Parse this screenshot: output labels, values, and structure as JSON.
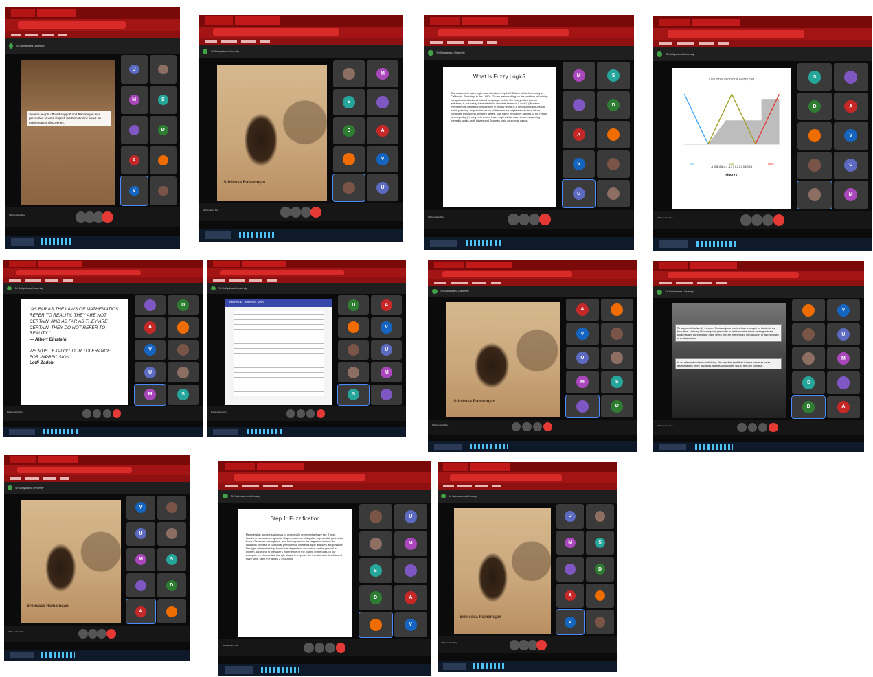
{
  "meeting": {
    "name": "Sri Sathyabama University",
    "day_label": "Mathematics Day"
  },
  "icons": [
    "tab-icon",
    "address-bar",
    "mic-icon",
    "camera-icon",
    "hand-icon",
    "end-call-icon",
    "search-icon"
  ],
  "colors": {
    "browser_red": "#a31414",
    "meet_dark": "#1f1f1f",
    "end_call": "#e53935",
    "accent_blue": "#4a8cff"
  },
  "shots": [
    {
      "slide": "book",
      "caption": "Several people offered support and Ramanujan was persuaded to write English mathematicians about his mathematical discoveries."
    },
    {
      "slide": "ramanujan",
      "stamp": "Srinivasa Ramanujan"
    },
    {
      "slide": "text",
      "heading": "What Is Fuzzy Logic?",
      "body": "The concept of fuzzy logic was introduced by Lotfi Zadeh of the University of California, Berkeley, in the 1960s. Zadeh was working on the problem of helping computers understand natural language, which, like many other human activities, is not easily translated into absolute terms of 0 and 1. (Whether everything is ultimately describable in binary terms is a philosophical question worth pursuing. In practice, much of the data we might want to feed into a computer exists in in-between states. The same frequently applies to the results of computing.) It may help to see fuzzy logic as the way human reasoning normally works, with binary and Boolean logic as special cases."
    },
    {
      "slide": "chart",
      "heading": "Defuzzification of a Fuzzy Set",
      "legend": [
        "Soft",
        "Avg",
        "Hard"
      ],
      "ticks": "-1 -0.8 -0.6 -0.4 -0.2 0 0.2 0.4 0.6 0.8 1",
      "figure": "Figure 7"
    },
    {
      "slide": "quote",
      "q1": "\"AS FAR AS THE LAWS OF MATHEMATICS REFER TO REALITY, THEY ARE NOT CERTAIN. AND AS FAR AS THEY ARE CERTAIN, THEY DO NOT REFER TO REALITY.\"",
      "a1": "— Albert Einstein",
      "q2": "WE MUST EXPLOIT OUR TOLERANCE FOR IMPRECISION.",
      "a2": "Lotfi Zadeh"
    },
    {
      "slide": "letter",
      "heading": "Letter to R. Krishna Rao"
    },
    {
      "slide": "ramanujan",
      "stamp": "Srinivasa Ramanujan"
    },
    {
      "slide": "portrait",
      "caption1": "To augment his family income, Ramanujan's mother took a couple of students as boarders. Noticing Ramanujan's precocity in mathematics these undergraduate students are purported to have given him an elementary introduction to all branches of mathematics.",
      "caption2": "In an arithmetic class on division, the teacher said that if three bananas were distributed to three students, then each student would get one banana."
    },
    {
      "slide": "ramanujan",
      "stamp": "Srinivasa Ramanujan"
    },
    {
      "slide": "text",
      "heading": "Step 1: Fuzzification",
      "body": "Membership functions allow us to graphically represent a fuzzy set. These functions can assume specific shapes, such as triangular, trapezoidal, piecewise linear, Gaussian or singleton, and help represent the degree of truth in the valuation process of particular phenomena where multiple answers are possible. The type of membership function is dependent on context and in general is chosen according to the user's experience or the nature of the data. In our example, we choose the triangle shape to express the membership functions of fuzzy sets, seen in Figures 2 through 6."
    },
    {
      "slide": "ramanujan",
      "stamp": "Srinivasa Ramanujan"
    }
  ]
}
